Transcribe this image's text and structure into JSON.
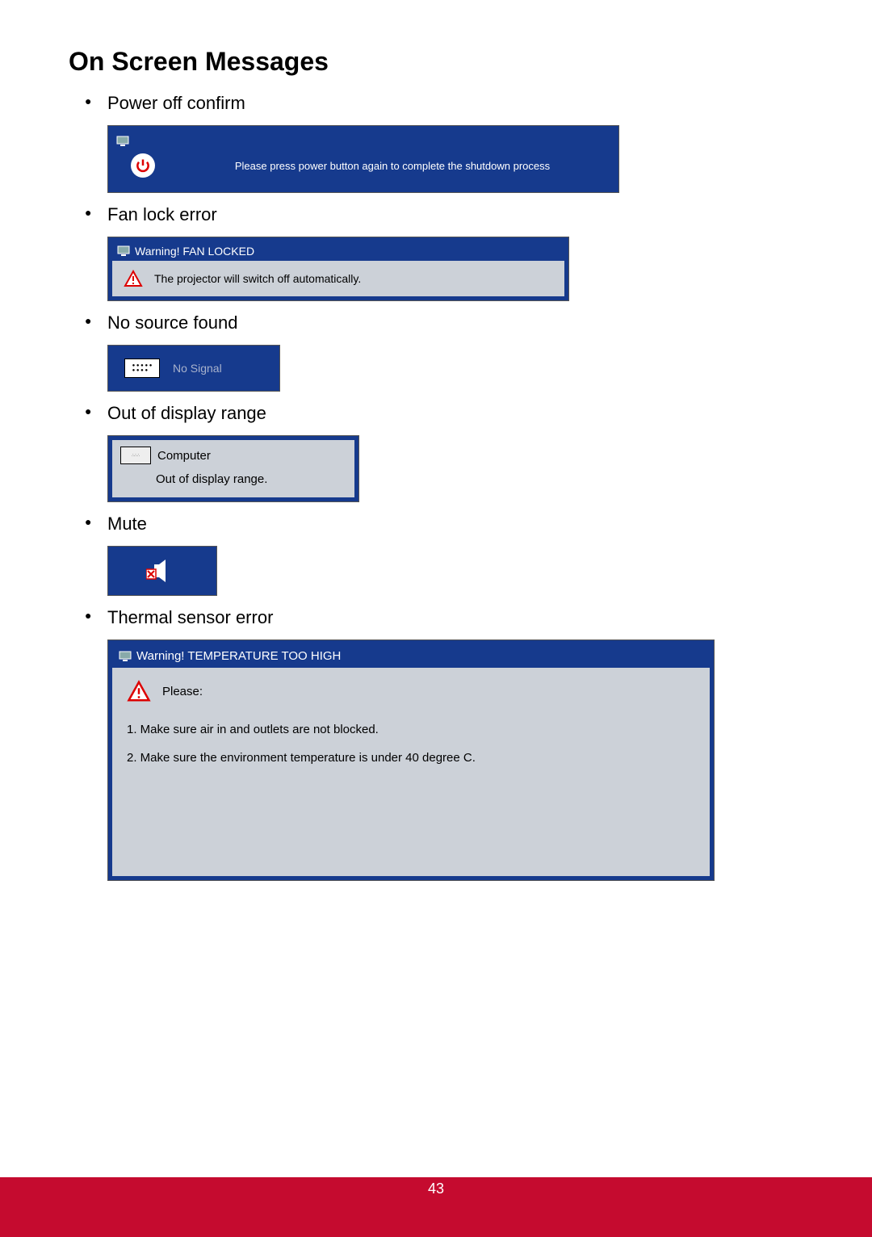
{
  "heading": "On Screen Messages",
  "items": {
    "power_off": {
      "label": "Power off confirm",
      "message": "Please press power button again to complete the shutdown process"
    },
    "fan_lock": {
      "label": "Fan lock error",
      "title": "Warning! FAN LOCKED",
      "message": "The projector will switch off automatically."
    },
    "no_source": {
      "label": "No source found",
      "message": "No Signal"
    },
    "out_of_range": {
      "label": "Out of display range",
      "source": "Computer",
      "message": "Out of display range."
    },
    "mute": {
      "label": "Mute"
    },
    "thermal": {
      "label": "Thermal sensor error",
      "title": "Warning! TEMPERATURE TOO HIGH",
      "please": "Please:",
      "line1": "1. Make sure air in and outlets are not blocked.",
      "line2": "2. Make sure the environment temperature is under 40 degree C."
    }
  },
  "page_number": "43"
}
